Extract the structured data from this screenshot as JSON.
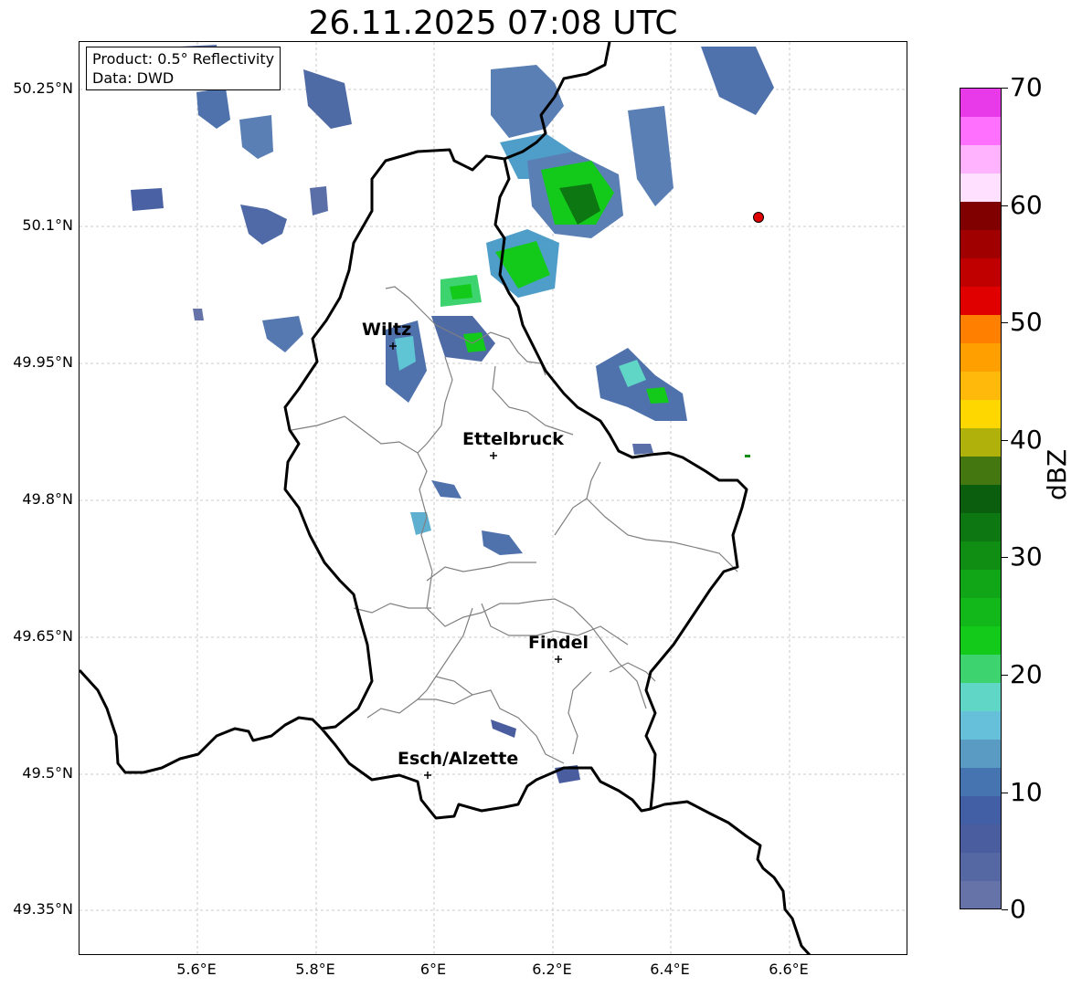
{
  "title": "26.11.2025 07:08 UTC",
  "info_box": {
    "product": "Product: 0.5° Reflectivity",
    "data": "Data: DWD"
  },
  "axes": {
    "lat_labels": [
      "50.25°N",
      "50.1°N",
      "49.95°N",
      "49.8°N",
      "49.65°N",
      "49.5°N",
      "49.35°N"
    ],
    "lon_labels": [
      "5.6°E",
      "5.8°E",
      "6°E",
      "6.2°E",
      "6.4°E",
      "6.6°E"
    ]
  },
  "cities": [
    {
      "name": "Wiltz"
    },
    {
      "name": "Ettelbruck"
    },
    {
      "name": "Findel"
    },
    {
      "name": "Esch/Alzette"
    }
  ],
  "colorbar": {
    "label": "dBZ",
    "ticks": [
      "0",
      "10",
      "20",
      "30",
      "40",
      "50",
      "60",
      "70"
    ],
    "colors": [
      "#6573a8",
      "#5668a3",
      "#4a5e9f",
      "#425fa6",
      "#4574b0",
      "#5a9bc4",
      "#66c0d9",
      "#5fd6c6",
      "#3dd470",
      "#13c91a",
      "#12b81a",
      "#11a617",
      "#108e14",
      "#0d7712",
      "#0b5e0e",
      "#457710",
      "#b0b10a",
      "#ffd700",
      "#ffb90a",
      "#ffa000",
      "#ff7f00",
      "#e10000",
      "#c00000",
      "#a00000",
      "#800000",
      "#ffe0ff",
      "#ffb3ff",
      "#ff70ff",
      "#e83ae8"
    ]
  },
  "radar_marker": {
    "color": "#e00000"
  }
}
